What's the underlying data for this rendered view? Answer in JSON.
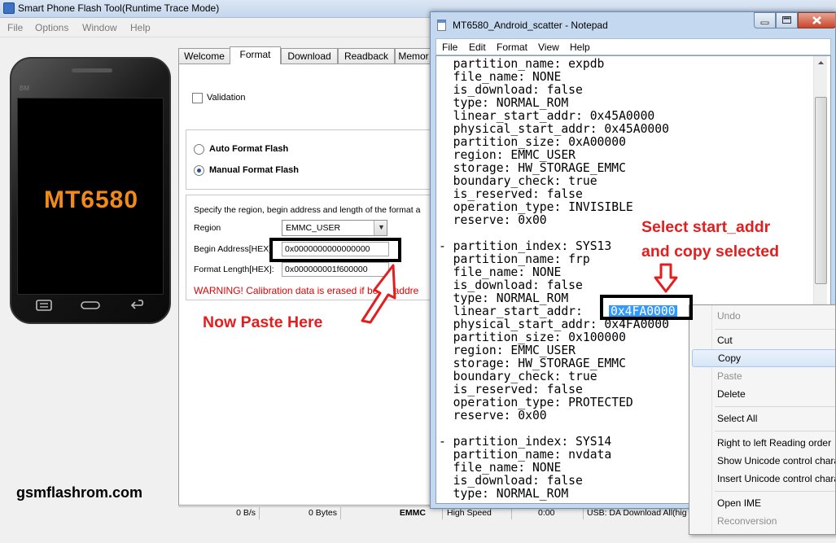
{
  "flash_tool": {
    "title": "Smart Phone Flash Tool(Runtime Trace Mode)",
    "menu": [
      "File",
      "Options",
      "Window",
      "Help"
    ],
    "phone": {
      "brand": "BM",
      "model": "MT6580"
    },
    "tabs": [
      "Welcome",
      "Format",
      "Download",
      "Readback",
      "Memor"
    ],
    "active_tab": "Format",
    "validation_label": "Validation",
    "auto_format_label": "Auto Format Flash",
    "manual_format_label": "Manual Format Flash",
    "selected_mode": "Manual Format Flash",
    "region_hint": "Specify the region, begin address and length of the format a",
    "region_label": "Region",
    "region_value": "EMMC_USER",
    "begin_address_label": "Begin Address[HEX]",
    "begin_address_value": "0x0000000000000000",
    "format_length_label": "Format Length[HEX]:",
    "format_length_value": "0x000000001f600000",
    "warning": "WARNING! Calibration data is erased if begin addre",
    "status": {
      "speed": "0 B/s",
      "bytes": "0 Bytes",
      "storage": "EMMC",
      "mode": "High Speed",
      "time": "0:00",
      "usb": "USB: DA Download All(hig"
    }
  },
  "watermark": "gsmflashrom.com",
  "notepad": {
    "title": "MT6580_Android_scatter - Notepad",
    "menu": [
      "File",
      "Edit",
      "Format",
      "View",
      "Help"
    ],
    "lines": [
      "  partition_name: expdb",
      "  file_name: NONE",
      "  is_download: false",
      "  type: NORMAL_ROM",
      "  linear_start_addr: 0x45A0000",
      "  physical_start_addr: 0x45A0000",
      "  partition_size: 0xA00000",
      "  region: EMMC_USER",
      "  storage: HW_STORAGE_EMMC",
      "  boundary_check: true",
      "  is_reserved: false",
      "  operation_type: INVISIBLE",
      "  reserve: 0x00",
      "",
      "- partition_index: SYS13",
      "  partition_name: frp",
      "  file_name: NONE",
      "  is_download: false",
      "  type: NORMAL_ROM",
      "  linear_start_addr: ",
      "  physical_start_addr: 0x4FA0000",
      "  partition_size: 0x100000",
      "  region: EMMC_USER",
      "  storage: HW_STORAGE_EMMC",
      "  boundary_check: true",
      "  is_reserved: false",
      "  operation_type: PROTECTED",
      "  reserve: 0x00",
      "",
      "- partition_index: SYS14",
      "  partition_name: nvdata",
      "  file_name: NONE",
      "  is_download: false",
      "  type: NORMAL_ROM"
    ],
    "selected_text": "0x4FA0000"
  },
  "context_menu": {
    "items": [
      {
        "label": "Undo",
        "disabled": true
      },
      {
        "label": "Cut",
        "disabled": false
      },
      {
        "label": "Copy",
        "disabled": false,
        "highlighted": true
      },
      {
        "label": "Paste",
        "disabled": true
      },
      {
        "label": "Delete",
        "disabled": false
      },
      {
        "label": "Select All",
        "disabled": false
      },
      {
        "label": "Right to left Reading order",
        "disabled": false
      },
      {
        "label": "Show Unicode control chara",
        "disabled": false
      },
      {
        "label": "Insert Unicode control chara",
        "disabled": false
      },
      {
        "label": "Open IME",
        "disabled": false
      },
      {
        "label": "Reconversion",
        "disabled": true
      }
    ]
  },
  "annotations": {
    "paste_here": "Now Paste Here",
    "select_line1": "Select start_addr",
    "select_line2": "and copy selected",
    "color": "#e41e1e"
  }
}
